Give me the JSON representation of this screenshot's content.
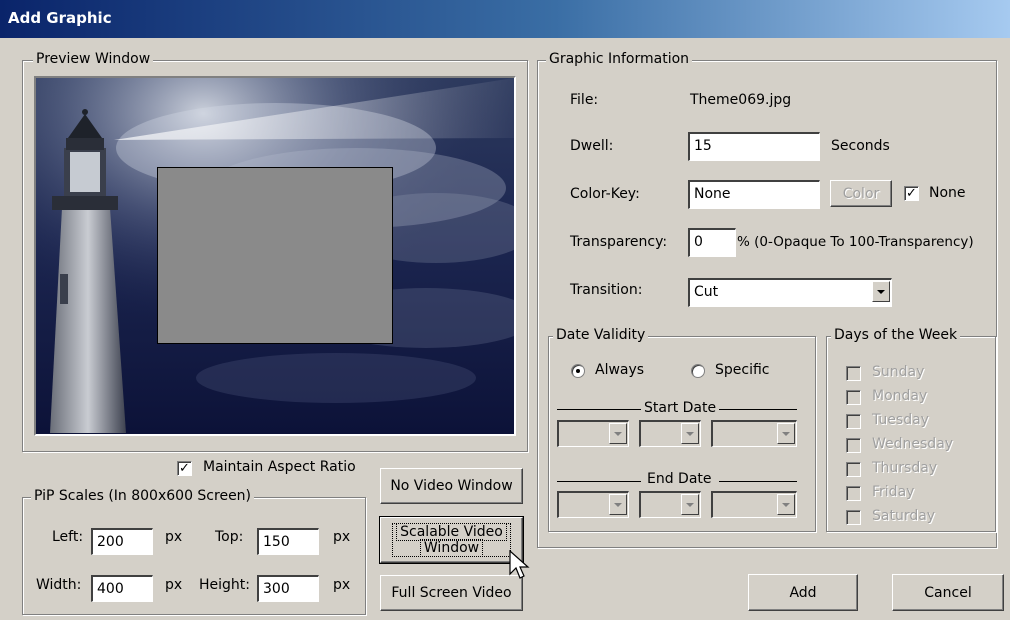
{
  "window": {
    "title": "Add Graphic"
  },
  "preview": {
    "legend": "Preview Window"
  },
  "options": {
    "maintain_aspect_ratio": {
      "label": "Maintain Aspect Ratio",
      "checked": true
    }
  },
  "pip": {
    "legend": "PiP Scales (In 800x600 Screen)",
    "left": {
      "label": "Left:",
      "value": "200",
      "unit": "px"
    },
    "top": {
      "label": "Top:",
      "value": "150",
      "unit": "px"
    },
    "width": {
      "label": "Width:",
      "value": "400",
      "unit": "px"
    },
    "height": {
      "label": "Height:",
      "value": "300",
      "unit": "px"
    }
  },
  "video_buttons": {
    "no_video": "No Video Window",
    "scalable_line1": "Scalable Video",
    "scalable_line2": "Window",
    "full_screen": "Full Screen Video"
  },
  "graphic_info": {
    "legend": "Graphic Information",
    "file_label": "File:",
    "file_value": "Theme069.jpg",
    "dwell_label": "Dwell:",
    "dwell_value": "15",
    "dwell_unit": "Seconds",
    "colorkey_label": "Color-Key:",
    "colorkey_value": "None",
    "color_button": "Color",
    "none_checkbox_label": "None",
    "none_checked": true,
    "transparency_label": "Transparency:",
    "transparency_value": "0",
    "transparency_hint": "% (0-Opaque To 100-Transparency)",
    "transition_label": "Transition:",
    "transition_value": "Cut"
  },
  "date_validity": {
    "legend": "Date Validity",
    "always_label": "Always",
    "specific_label": "Specific",
    "selected": "Always",
    "start_date_label": "Start Date",
    "end_date_label": "End Date"
  },
  "days": {
    "legend": "Days of the Week",
    "items": [
      "Sunday",
      "Monday",
      "Tuesday",
      "Wednesday",
      "Thursday",
      "Friday",
      "Saturday"
    ]
  },
  "actions": {
    "add": "Add",
    "cancel": "Cancel"
  }
}
